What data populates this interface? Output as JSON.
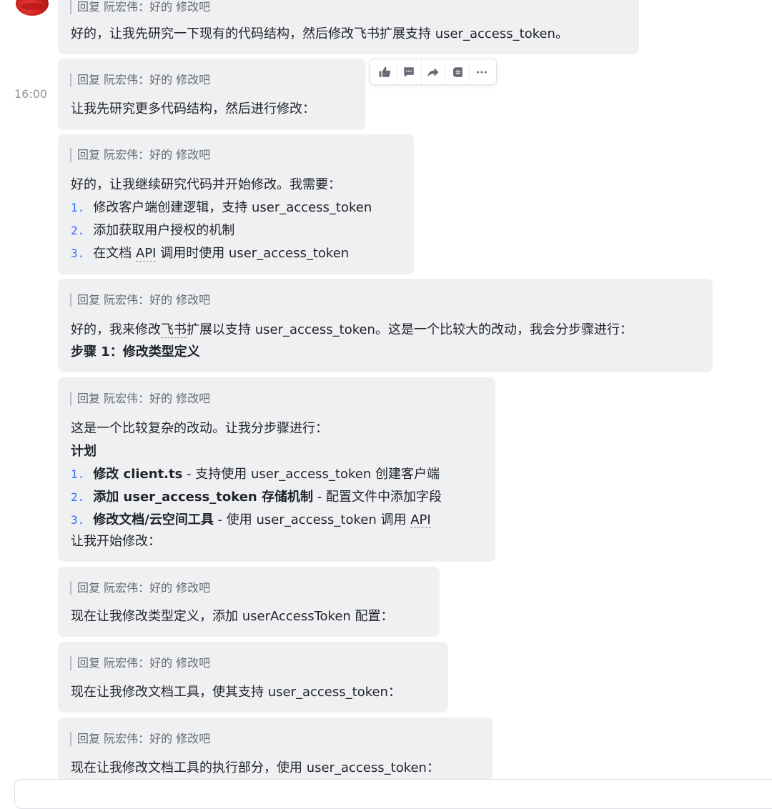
{
  "time_label": "16:00",
  "toolbar": {
    "icons": [
      "thumbs-up-icon",
      "comment-icon",
      "forward-icon",
      "reply-icon",
      "more-icon"
    ]
  },
  "messages": [
    {
      "quote": "回复 阮宏伟：好的 修改吧",
      "line1": "好的，让我先研究一下现有的代码结构，然后修改飞书扩展支持 user_access_token。"
    },
    {
      "quote": "回复 阮宏伟：好的 修改吧",
      "line1": "让我先研究更多代码结构，然后进行修改："
    },
    {
      "quote": "回复 阮宏伟：好的 修改吧",
      "line1": "好的，让我继续研究代码并开始修改。我需要：",
      "items": [
        {
          "num": "1.",
          "text": "修改客户端创建逻辑，支持 user_access_token"
        },
        {
          "num": "2.",
          "text": "添加获取用户授权的机制"
        },
        {
          "num": "3.",
          "pre": "在文档 ",
          "api": "API",
          "post": " 调用时使用 user_access_token"
        }
      ]
    },
    {
      "quote": "回复 阮宏伟：好的 修改吧",
      "line1_pre": "好的，我来修改",
      "line1_dotted": "飞书",
      "line1_post": "扩展以支持 user_access_token。这是一个比较大的改动，我会分步骤进行：",
      "line2": "步骤 1：修改类型定义"
    },
    {
      "quote": "回复 阮宏伟：好的 修改吧",
      "line1": "这是一个比较复杂的改动。让我分步骤进行：",
      "heading": "计划",
      "items": [
        {
          "num": "1.",
          "bold": "修改 client.ts",
          "text": " - 支持使用 user_access_token 创建客户端"
        },
        {
          "num": "2.",
          "bold": "添加 user_access_token 存储机制",
          "text": " - 配置文件中添加字段"
        },
        {
          "num": "3.",
          "bold": "修改文档/云空间工具",
          "text": " - 使用 user_access_token 调用 ",
          "api": "API"
        }
      ],
      "tail": "让我开始修改："
    },
    {
      "quote": "回复 阮宏伟：好的 修改吧",
      "line1": "现在让我修改类型定义，添加 userAccessToken 配置："
    },
    {
      "quote": "回复 阮宏伟：好的 修改吧",
      "line1": "现在让我修改文档工具，使其支持 user_access_token："
    },
    {
      "quote": "回复 阮宏伟：好的 修改吧",
      "line1": "现在让我修改文档工具的执行部分，使用 user_access_token："
    }
  ]
}
